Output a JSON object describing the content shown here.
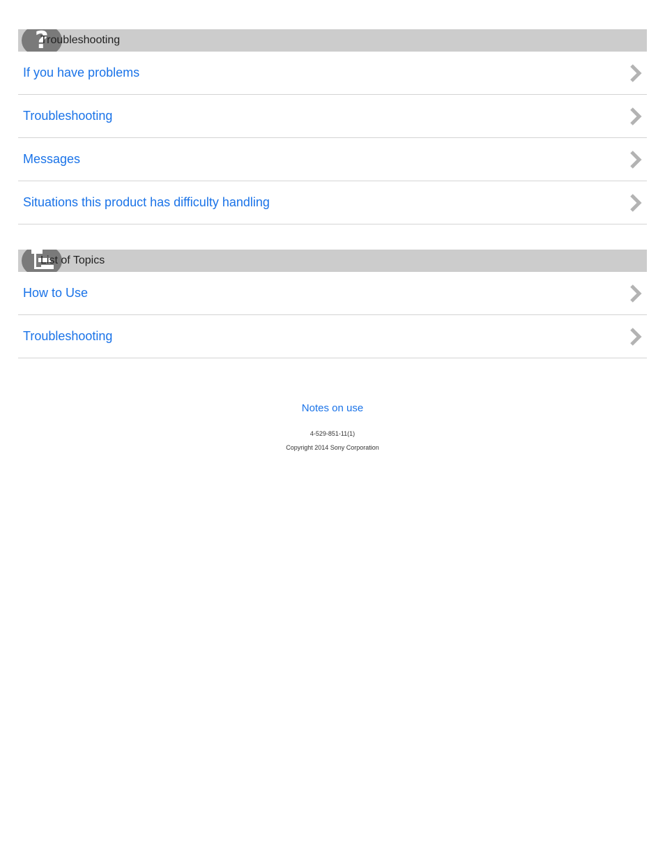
{
  "sections": [
    {
      "header_icon": "question-icon",
      "title": "Troubleshooting",
      "items": [
        {
          "label": "If you have problems"
        },
        {
          "label": "Troubleshooting"
        },
        {
          "label": "Messages"
        },
        {
          "label": "Situations this product has difficulty handling"
        }
      ]
    },
    {
      "header_icon": "list-icon",
      "title": "List of Topics",
      "items": [
        {
          "label": "How to Use"
        },
        {
          "label": "Troubleshooting"
        }
      ]
    }
  ],
  "footer": {
    "link": "Notes on use",
    "model_number": "4-529-851-11(1)",
    "copyright": "Copyright 2014 Sony Corporation"
  },
  "colors": {
    "link": "#1a73e8",
    "header_bg": "#cccccc",
    "icon_bg": "#7a7a7a",
    "chevron": "#b3b3b3"
  }
}
